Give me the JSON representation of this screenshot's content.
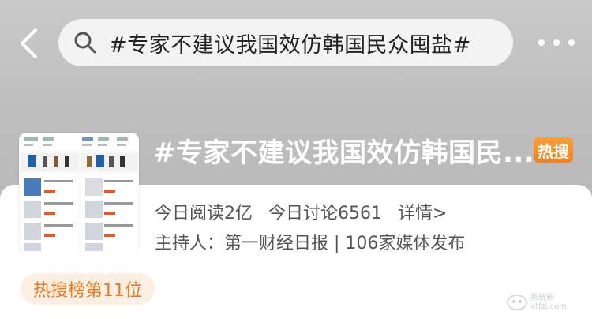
{
  "search": {
    "query": "#专家不建议我国效仿韩国民众囤盐#"
  },
  "topic": {
    "title": "#专家不建议我国效仿韩国民...",
    "badge": "热搜",
    "read_label": "今日阅读2亿",
    "discuss_label": "今日讨论6561",
    "detail_link": "详情>",
    "host_line": "主持人：第一财经日报 | 106家媒体发布",
    "rank_label": "热搜榜第11位"
  },
  "watermark": {
    "text": "系统粉",
    "url": "xtfzj.com"
  },
  "colors": {
    "badge_orange": "#f2811f",
    "rank_bg": "#fbeee2",
    "rank_text": "#e87a23"
  }
}
